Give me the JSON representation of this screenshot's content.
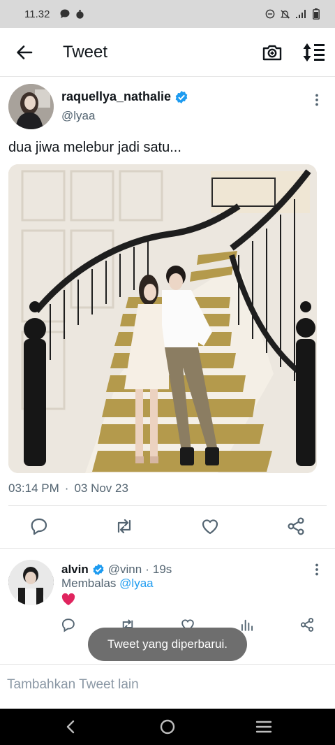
{
  "status_bar": {
    "time": "11.32",
    "left_icons": [
      "chat-bubble-icon",
      "timer-icon"
    ],
    "right_icons": [
      "minus-circle-icon",
      "bell-off-icon",
      "signal-icon",
      "battery-icon"
    ]
  },
  "header": {
    "title": "Tweet",
    "icons": [
      "back-arrow-icon",
      "camera-plus-icon",
      "sort-icon"
    ]
  },
  "tweet": {
    "display_name": "raquellya_nathalie",
    "verified": true,
    "handle": "@lyaa",
    "text": "dua jiwa melebur jadi satu...",
    "time": "03:14 PM",
    "separator": "·",
    "date": "03 Nov 23",
    "actions": [
      "reply-icon",
      "retweet-icon",
      "like-icon",
      "share-icon"
    ]
  },
  "reply": {
    "display_name": "alvin",
    "verified": true,
    "handle": "@vinn",
    "separator": "·",
    "time": "19s",
    "replying_prefix": "Membalas",
    "replying_to": "@lyaa",
    "text": "❤️",
    "actions": [
      "reply-icon",
      "retweet-icon",
      "like-icon",
      "stats-icon",
      "share-icon"
    ]
  },
  "toast": "Tweet yang diperbarui.",
  "compose": {
    "placeholder": "Tambahkan Tweet lain"
  },
  "colors": {
    "accent": "#1d9bf0",
    "text": "#0f1419",
    "secondary_text": "#536471",
    "status_bar": "#d9d9d9",
    "toast": "#6e6e6e",
    "heart": "#e0245e"
  }
}
